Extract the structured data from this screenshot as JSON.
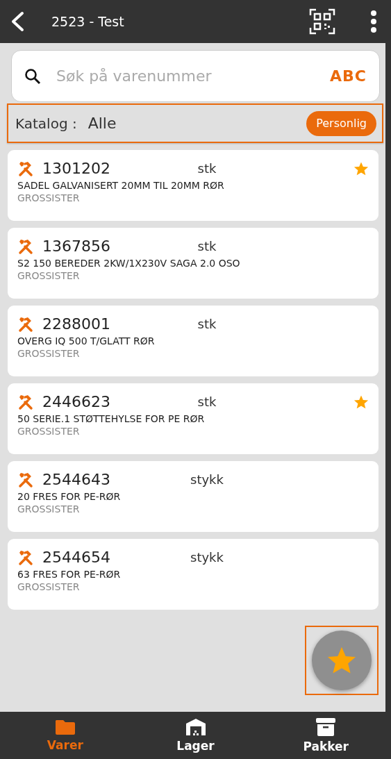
{
  "header": {
    "title": "2523 - Test"
  },
  "search": {
    "placeholder": "Søk på varenummer",
    "mode_label": "ABC"
  },
  "catalog": {
    "label": "Katalog :",
    "value": "Alle",
    "filter_button": "Personlig",
    "highlighted": true
  },
  "items": [
    {
      "number": "1301202",
      "unit": "stk",
      "description": "SADEL GALVANISERT 20MM TIL 20MM RØR",
      "source": "GROSSISTER",
      "favorite": true
    },
    {
      "number": "1367856",
      "unit": "stk",
      "description": "S2 150 BEREDER 2KW/1X230V SAGA 2.0 OSO",
      "source": "GROSSISTER",
      "favorite": false
    },
    {
      "number": "2288001",
      "unit": "stk",
      "description": "OVERG IQ 500 T/GLATT RØR",
      "source": "GROSSISTER",
      "favorite": false
    },
    {
      "number": "2446623",
      "unit": "stk",
      "description": "50 SERIE.1 STØTTEHYLSE FOR PE RØR",
      "source": "GROSSISTER",
      "favorite": true
    },
    {
      "number": "2544643",
      "unit": "stykk",
      "description": "20 FRES FOR PE-RØR",
      "source": "GROSSISTER",
      "favorite": false
    },
    {
      "number": "2544654",
      "unit": "stykk",
      "description": "63 FRES FOR PE-RØR",
      "source": "GROSSISTER",
      "favorite": false
    }
  ],
  "fab": {
    "highlighted": true
  },
  "tabs": [
    {
      "label": "Varer",
      "kind": "folder",
      "selected": true
    },
    {
      "label": "Lager",
      "kind": "warehouse",
      "selected": false
    },
    {
      "label": "Pakker",
      "kind": "archive",
      "selected": false
    }
  ]
}
